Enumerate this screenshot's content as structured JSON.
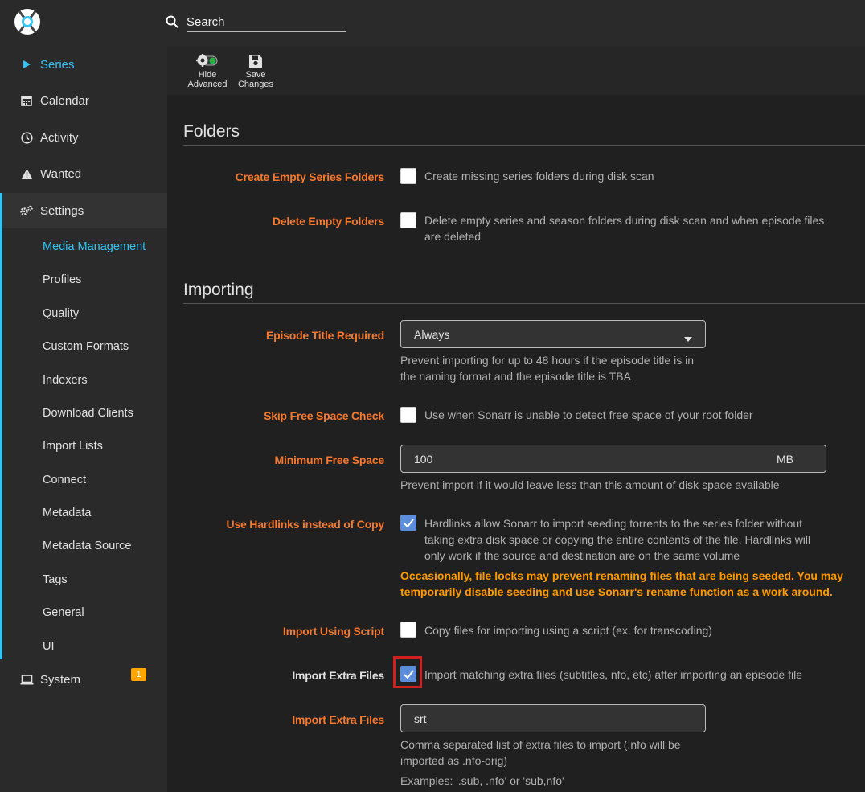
{
  "search": {
    "placeholder": "Search"
  },
  "sidebar": {
    "items": [
      {
        "label": "Series",
        "icon": "play-icon"
      },
      {
        "label": "Calendar",
        "icon": "calendar-icon"
      },
      {
        "label": "Activity",
        "icon": "clock-icon"
      },
      {
        "label": "Wanted",
        "icon": "warning-icon"
      }
    ],
    "settings": {
      "label": "Settings",
      "icon": "cogs-icon",
      "sub_items": [
        "Media Management",
        "Profiles",
        "Quality",
        "Custom Formats",
        "Indexers",
        "Download Clients",
        "Import Lists",
        "Connect",
        "Metadata",
        "Metadata Source",
        "Tags",
        "General",
        "UI"
      ]
    },
    "system": {
      "label": "System",
      "icon": "laptop-icon",
      "badge": "1"
    }
  },
  "toolbar": {
    "hide_advanced": [
      "Hide",
      "Advanced"
    ],
    "save_changes": [
      "Save",
      "Changes"
    ]
  },
  "folders": {
    "title": "Folders",
    "create_empty": {
      "label": "Create Empty Series Folders",
      "help": "Create missing series folders during disk scan",
      "checked": false
    },
    "delete_empty": {
      "label": "Delete Empty Folders",
      "help": [
        "Delete empty series and season folders during disk scan and when episode files",
        "are deleted"
      ],
      "checked": false
    }
  },
  "importing": {
    "title": "Importing",
    "episode_title": {
      "label": "Episode Title Required",
      "value": "Always",
      "help": [
        "Prevent importing for up to 48 hours if the episode title is in",
        "the naming format and the episode title is TBA"
      ]
    },
    "skip_free_space": {
      "label": "Skip Free Space Check",
      "help": "Use when Sonarr is unable to detect free space of your root folder",
      "checked": false
    },
    "min_free_space": {
      "label": "Minimum Free Space",
      "value": "100",
      "unit": "MB",
      "help": "Prevent import if it would leave less than this amount of disk space available"
    },
    "hardlinks": {
      "label": "Use Hardlinks instead of Copy",
      "checked": true,
      "help": [
        "Hardlinks allow Sonarr to import seeding torrents to the series folder without",
        "taking extra disk space or copying the entire contents of the file. Hardlinks will",
        "only work if the source and destination are on the same volume"
      ],
      "warning": [
        "Occasionally, file locks may prevent renaming files that are being seeded. You may",
        "temporarily disable seeding and use Sonarr's rename function as a work around."
      ]
    },
    "import_script": {
      "label": "Import Using Script",
      "help": "Copy files for importing using a script (ex. for transcoding)",
      "checked": false
    },
    "import_extra": {
      "label": "Import Extra Files",
      "help": "Import matching extra files (subtitles, nfo, etc) after importing an episode file",
      "checked": true
    },
    "extra_extensions": {
      "label": "Import Extra Files",
      "value": "srt",
      "help": [
        "Comma separated list of extra files to import (.nfo will be",
        "imported as .nfo-orig)"
      ],
      "examples": "Examples: '.sub, .nfo' or 'sub,nfo'"
    }
  },
  "colors": {
    "accent": "#35c5f4",
    "label_orange": "#f5792f",
    "warning": "#ff9900",
    "checkbox": "#5b8dd9",
    "highlight": "#d21f1f"
  }
}
